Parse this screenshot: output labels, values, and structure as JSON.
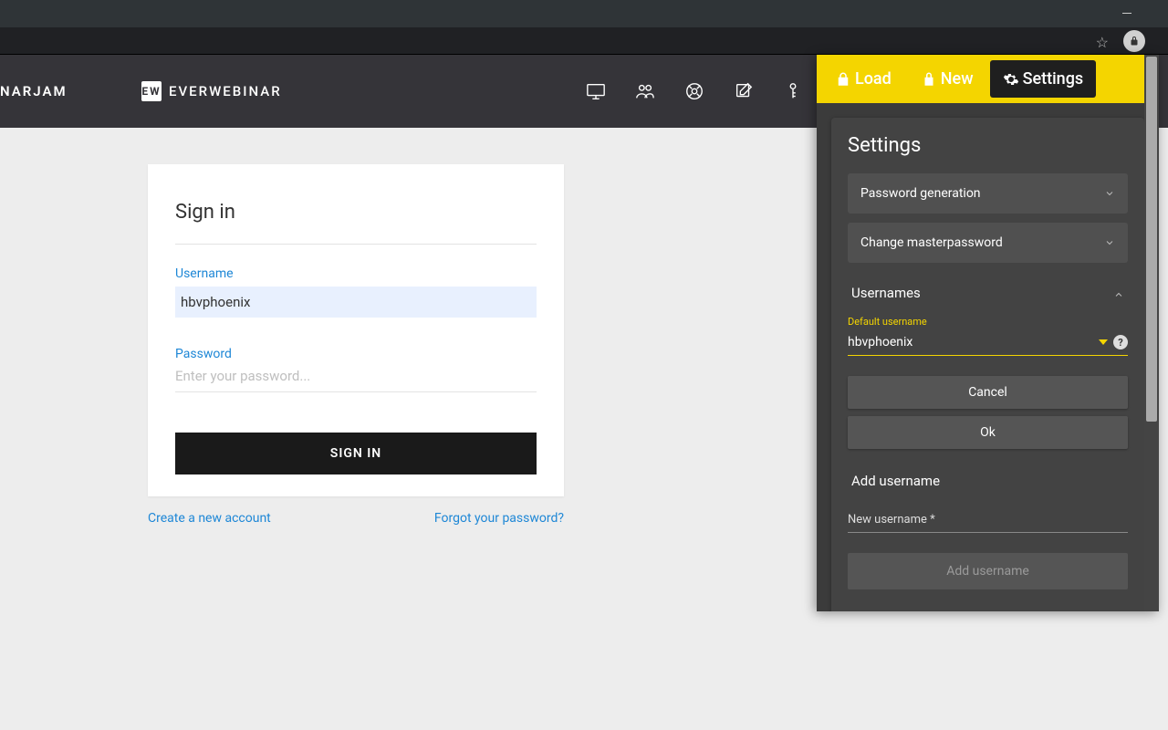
{
  "header": {
    "brand_left": "NARJAM",
    "brand_mid_logo": "EW",
    "brand_mid_text": "EVERWEBINAR"
  },
  "signin": {
    "title": "Sign in",
    "username_label": "Username",
    "username_value": "hbvphoenix",
    "password_label": "Password",
    "password_placeholder": "Enter your password...",
    "button": "SIGN IN",
    "create_link": "Create a new account",
    "forgot_link": "Forgot your password?"
  },
  "ext": {
    "tabs": {
      "load": "Load",
      "new": "New",
      "settings": "Settings"
    },
    "title": "Settings",
    "accordion": {
      "pwgen": "Password generation",
      "master": "Change masterpassword",
      "usernames": "Usernames"
    },
    "usernames": {
      "default_label": "Default username",
      "default_value": "hbvphoenix",
      "cancel": "Cancel",
      "ok": "Ok",
      "add_title": "Add username",
      "new_label": "New username *",
      "add_btn": "Add username"
    }
  }
}
